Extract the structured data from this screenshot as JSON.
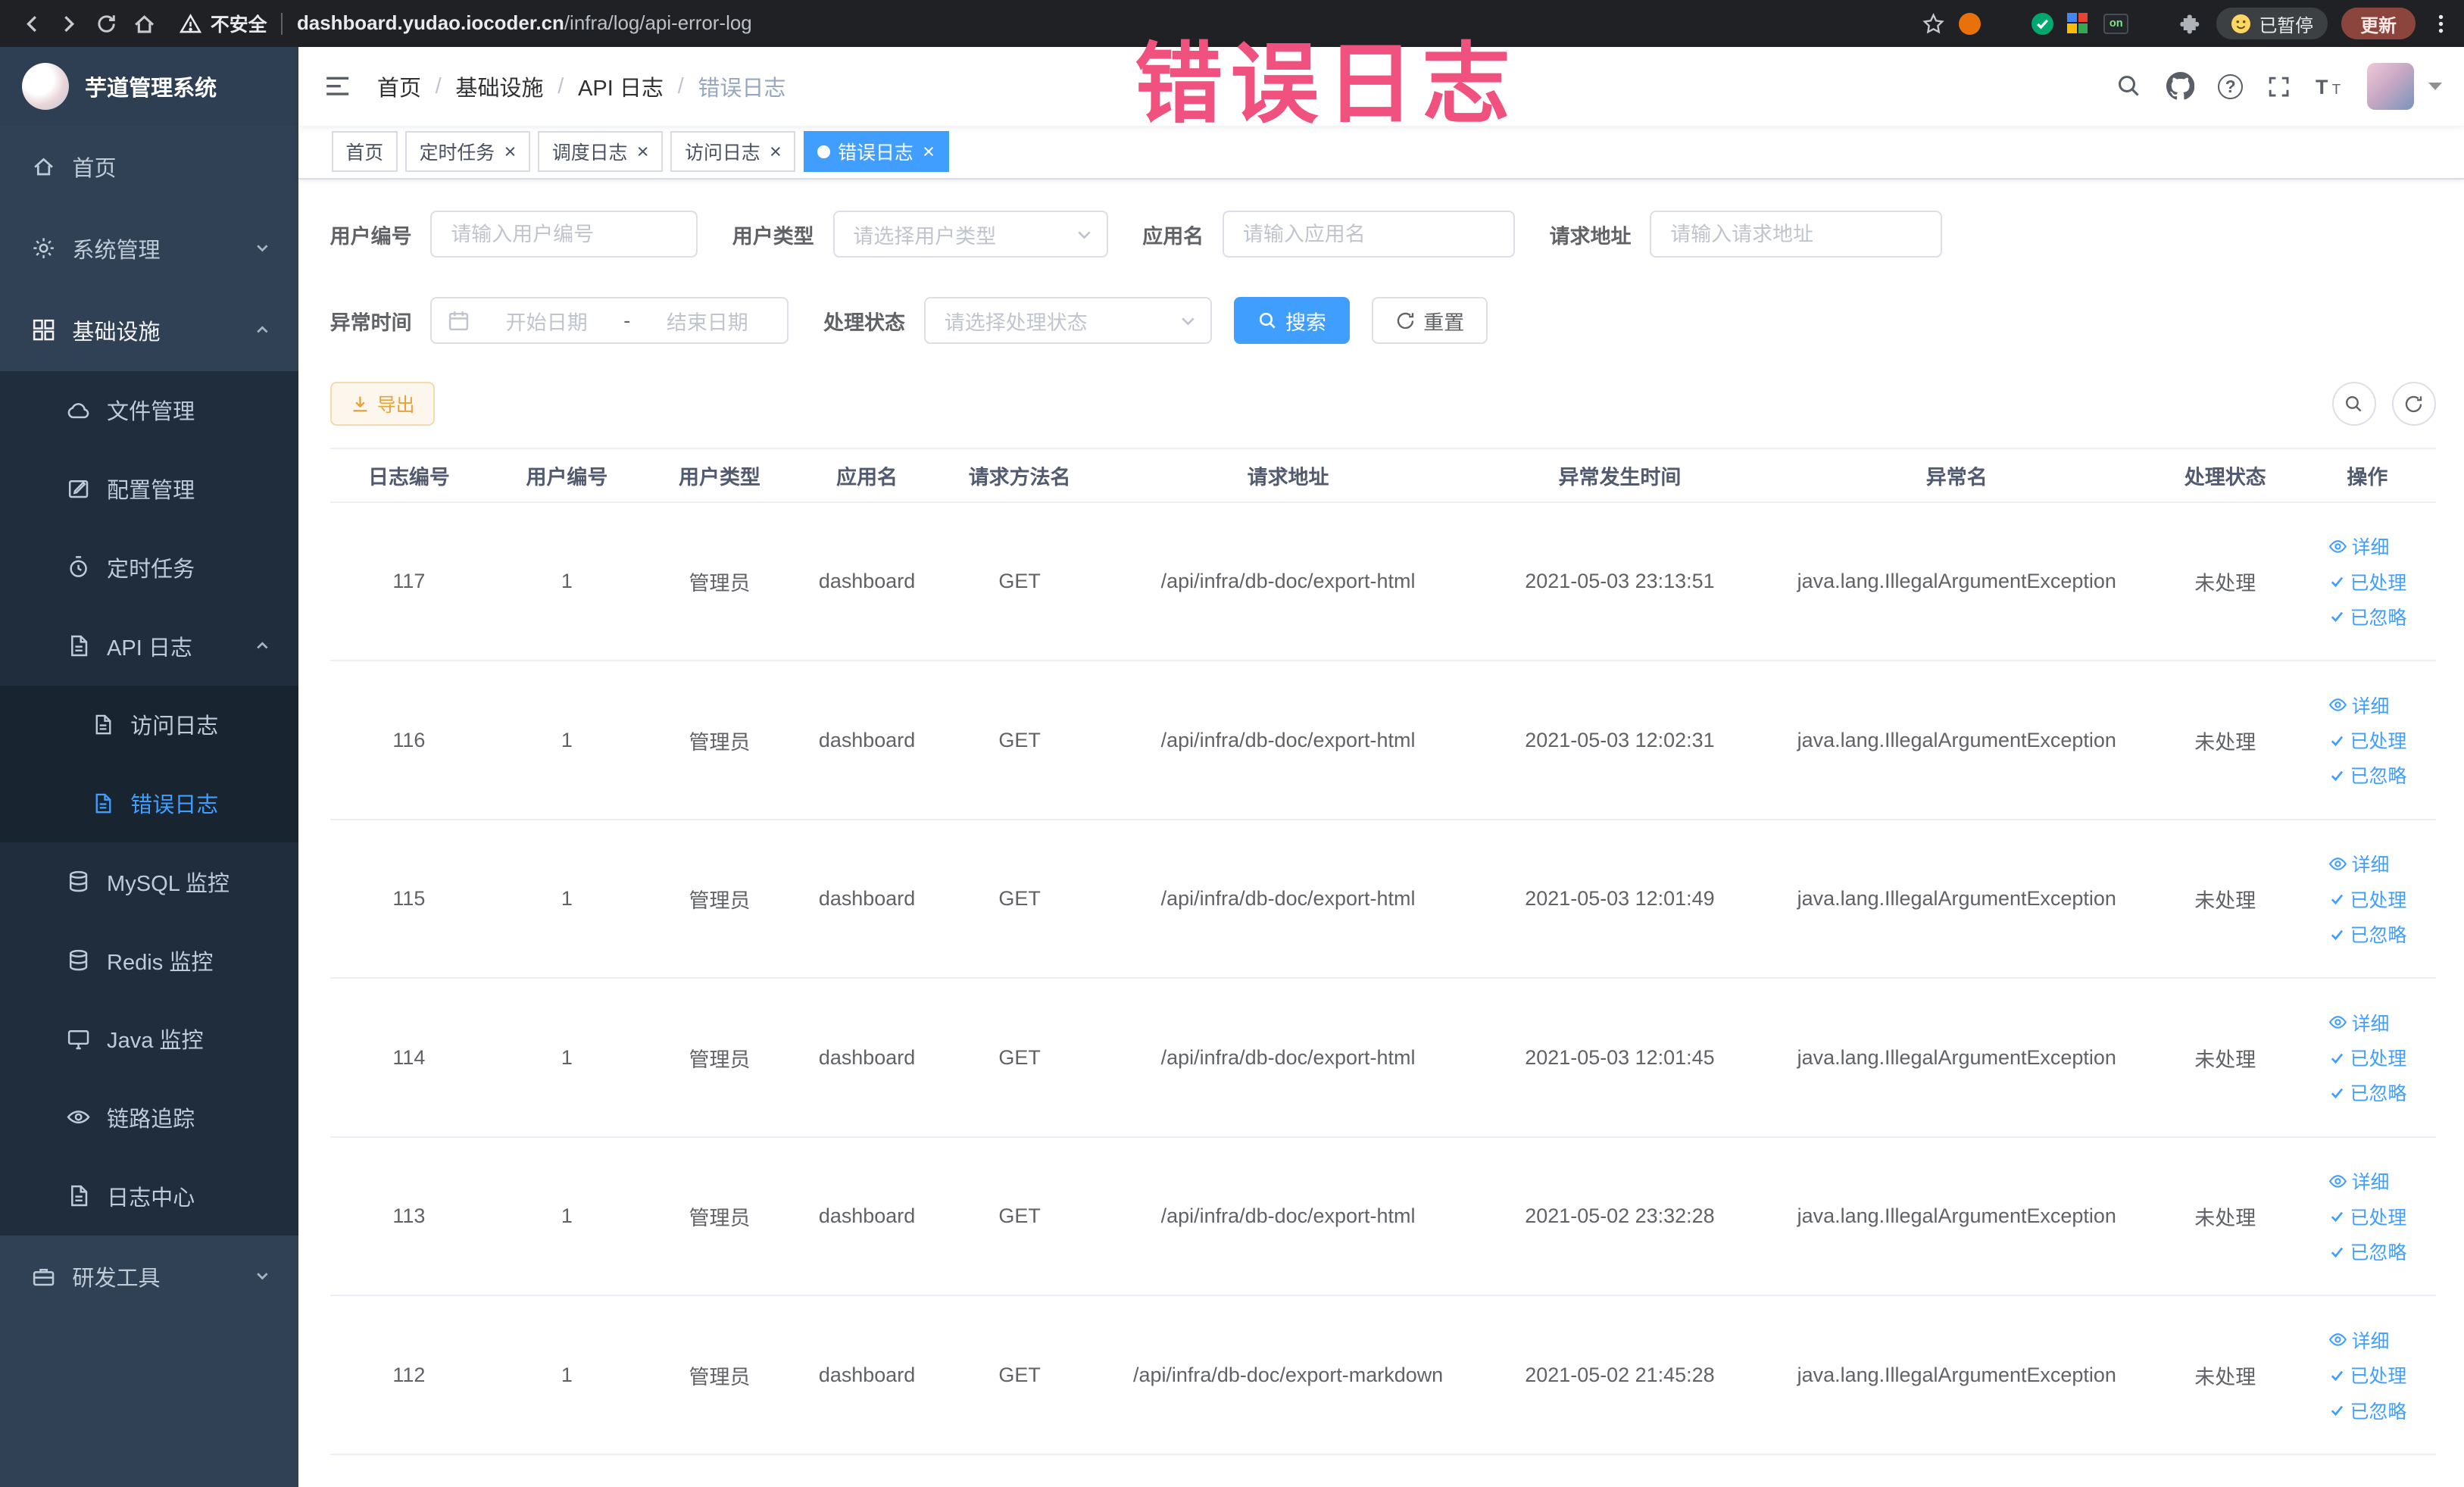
{
  "annotation": {
    "text": "错误日志"
  },
  "browser": {
    "security_label": "不安全",
    "url_domain": "dashboard.yudao.iocoder.cn",
    "url_path": "/infra/log/api-error-log",
    "ext_on_badge": "on",
    "paused_badge": "已暂停",
    "update_button": "更新"
  },
  "sidebar": {
    "logo_title": "芋道管理系统",
    "home": "首页",
    "system": "系统管理",
    "infra": "基础设施",
    "file": "文件管理",
    "config": "配置管理",
    "job": "定时任务",
    "api_log": "API 日志",
    "access_log": "访问日志",
    "error_log": "错误日志",
    "mysql": "MySQL 监控",
    "redis": "Redis 监控",
    "java": "Java 监控",
    "trace": "链路追踪",
    "log_center": "日志中心",
    "dev_tools": "研发工具"
  },
  "header": {
    "breadcrumb": [
      "首页",
      "基础设施",
      "API 日志",
      "错误日志"
    ]
  },
  "tabs": [
    {
      "label": "首页"
    },
    {
      "label": "定时任务"
    },
    {
      "label": "调度日志"
    },
    {
      "label": "访问日志"
    },
    {
      "label": "错误日志"
    }
  ],
  "filters": {
    "user_id_label": "用户编号",
    "user_id_placeholder": "请输入用户编号",
    "user_type_label": "用户类型",
    "user_type_placeholder": "请选择用户类型",
    "app_name_label": "应用名",
    "app_name_placeholder": "请输入应用名",
    "request_url_label": "请求地址",
    "request_url_placeholder": "请输入请求地址",
    "exception_time_label": "异常时间",
    "start_date_placeholder": "开始日期",
    "range_separator": "-",
    "end_date_placeholder": "结束日期",
    "process_status_label": "处理状态",
    "process_status_placeholder": "请选择处理状态",
    "search_button": "搜索",
    "reset_button": "重置"
  },
  "toolbar": {
    "export_button": "导出"
  },
  "icons": {
    "header_right": [
      "search-icon",
      "github-icon",
      "question-icon",
      "fullscreen-icon",
      "font-size-icon"
    ],
    "table_toolbar_right": [
      "search-icon",
      "refresh-icon"
    ]
  },
  "table": {
    "columns": [
      "日志编号",
      "用户编号",
      "用户类型",
      "应用名",
      "请求方法名",
      "请求地址",
      "异常发生时间",
      "异常名",
      "处理状态",
      "操作"
    ],
    "actions": {
      "detail": "详细",
      "processed": "已处理",
      "ignored": "已忽略"
    },
    "rows": [
      {
        "id": "117",
        "user_id": "1",
        "user_type": "管理员",
        "app": "dashboard",
        "method": "GET",
        "url": "/api/infra/db-doc/export-html",
        "time": "2021-05-03 23:13:51",
        "exception": "java.lang.IllegalArgumentException",
        "status": "未处理"
      },
      {
        "id": "116",
        "user_id": "1",
        "user_type": "管理员",
        "app": "dashboard",
        "method": "GET",
        "url": "/api/infra/db-doc/export-html",
        "time": "2021-05-03 12:02:31",
        "exception": "java.lang.IllegalArgumentException",
        "status": "未处理"
      },
      {
        "id": "115",
        "user_id": "1",
        "user_type": "管理员",
        "app": "dashboard",
        "method": "GET",
        "url": "/api/infra/db-doc/export-html",
        "time": "2021-05-03 12:01:49",
        "exception": "java.lang.IllegalArgumentException",
        "status": "未处理"
      },
      {
        "id": "114",
        "user_id": "1",
        "user_type": "管理员",
        "app": "dashboard",
        "method": "GET",
        "url": "/api/infra/db-doc/export-html",
        "time": "2021-05-03 12:01:45",
        "exception": "java.lang.IllegalArgumentException",
        "status": "未处理"
      },
      {
        "id": "113",
        "user_id": "1",
        "user_type": "管理员",
        "app": "dashboard",
        "method": "GET",
        "url": "/api/infra/db-doc/export-html",
        "time": "2021-05-02 23:32:28",
        "exception": "java.lang.IllegalArgumentException",
        "status": "未处理"
      },
      {
        "id": "112",
        "user_id": "1",
        "user_type": "管理员",
        "app": "dashboard",
        "method": "GET",
        "url": "/api/infra/db-doc/export-markdown",
        "time": "2021-05-02 21:45:28",
        "exception": "java.lang.IllegalArgumentException",
        "status": "未处理"
      }
    ]
  },
  "colors": {
    "accent": "#409eff",
    "warning_text": "#e6a23c",
    "annotation_pink": "#f0517e",
    "sidebar_bg": "#304156",
    "submenu_bg": "#1f2d3d"
  }
}
